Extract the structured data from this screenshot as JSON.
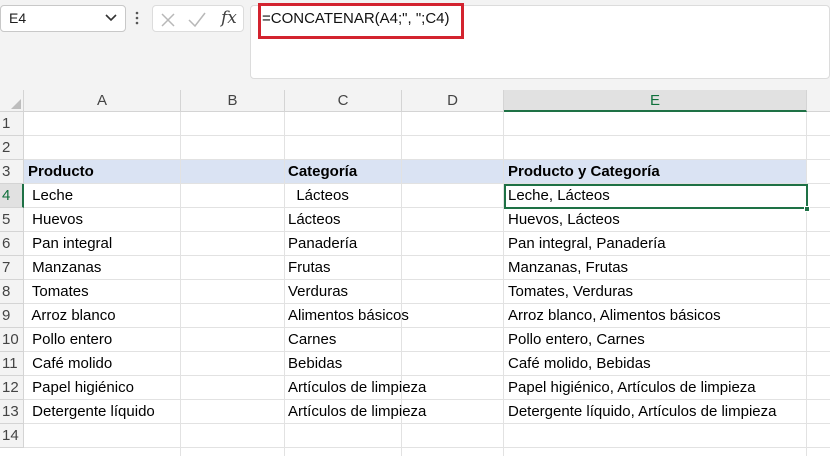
{
  "name_box": {
    "value": "E4",
    "dropdown_icon": "chevron-down-icon"
  },
  "formula_bar": {
    "cancel_icon": "close-icon",
    "enter_icon": "check-icon",
    "function_label": "fx",
    "formula": "=CONCATENAR(A4;\", \";C4)"
  },
  "columns": [
    "A",
    "B",
    "C",
    "D",
    "E"
  ],
  "selected_column": "E",
  "rows": [
    "1",
    "2",
    "3",
    "4",
    "5",
    "6",
    "7",
    "8",
    "9",
    "10",
    "11",
    "12",
    "13",
    "14"
  ],
  "selected_row": "4",
  "headers": {
    "product": "Producto",
    "category": "Categoría",
    "combined": "Producto y Categoría"
  },
  "data_rows": [
    {
      "product": " Leche",
      "category": "  Lácteos",
      "combined": "Leche, Lácteos"
    },
    {
      "product": " Huevos",
      "category": "Lácteos",
      "combined": "Huevos, Lácteos"
    },
    {
      "product": " Pan integral",
      "category": "Panadería",
      "combined": "Pan integral, Panadería"
    },
    {
      "product": " Manzanas",
      "category": "Frutas",
      "combined": "Manzanas, Frutas"
    },
    {
      "product": " Tomates",
      "category": "Verduras",
      "combined": "Tomates, Verduras"
    },
    {
      "product": " Arroz blanco",
      "category": "Alimentos básicos",
      "combined": "Arroz blanco, Alimentos básicos"
    },
    {
      "product": " Pollo entero",
      "category": "Carnes",
      "combined": "Pollo entero, Carnes"
    },
    {
      "product": " Café molido",
      "category": "Bebidas",
      "combined": "Café molido, Bebidas"
    },
    {
      "product": " Papel higiénico",
      "category": "Artículos de limpieza",
      "combined": "Papel higiénico, Artículos de limpieza"
    },
    {
      "product": " Detergente líquido",
      "category": "Artículos de limpieza",
      "combined": "Detergente líquido, Artículos de limpieza"
    }
  ],
  "colors": {
    "accent_green": "#1e7145",
    "highlight_red": "#d3232f",
    "header_band": "#dae3f3"
  }
}
